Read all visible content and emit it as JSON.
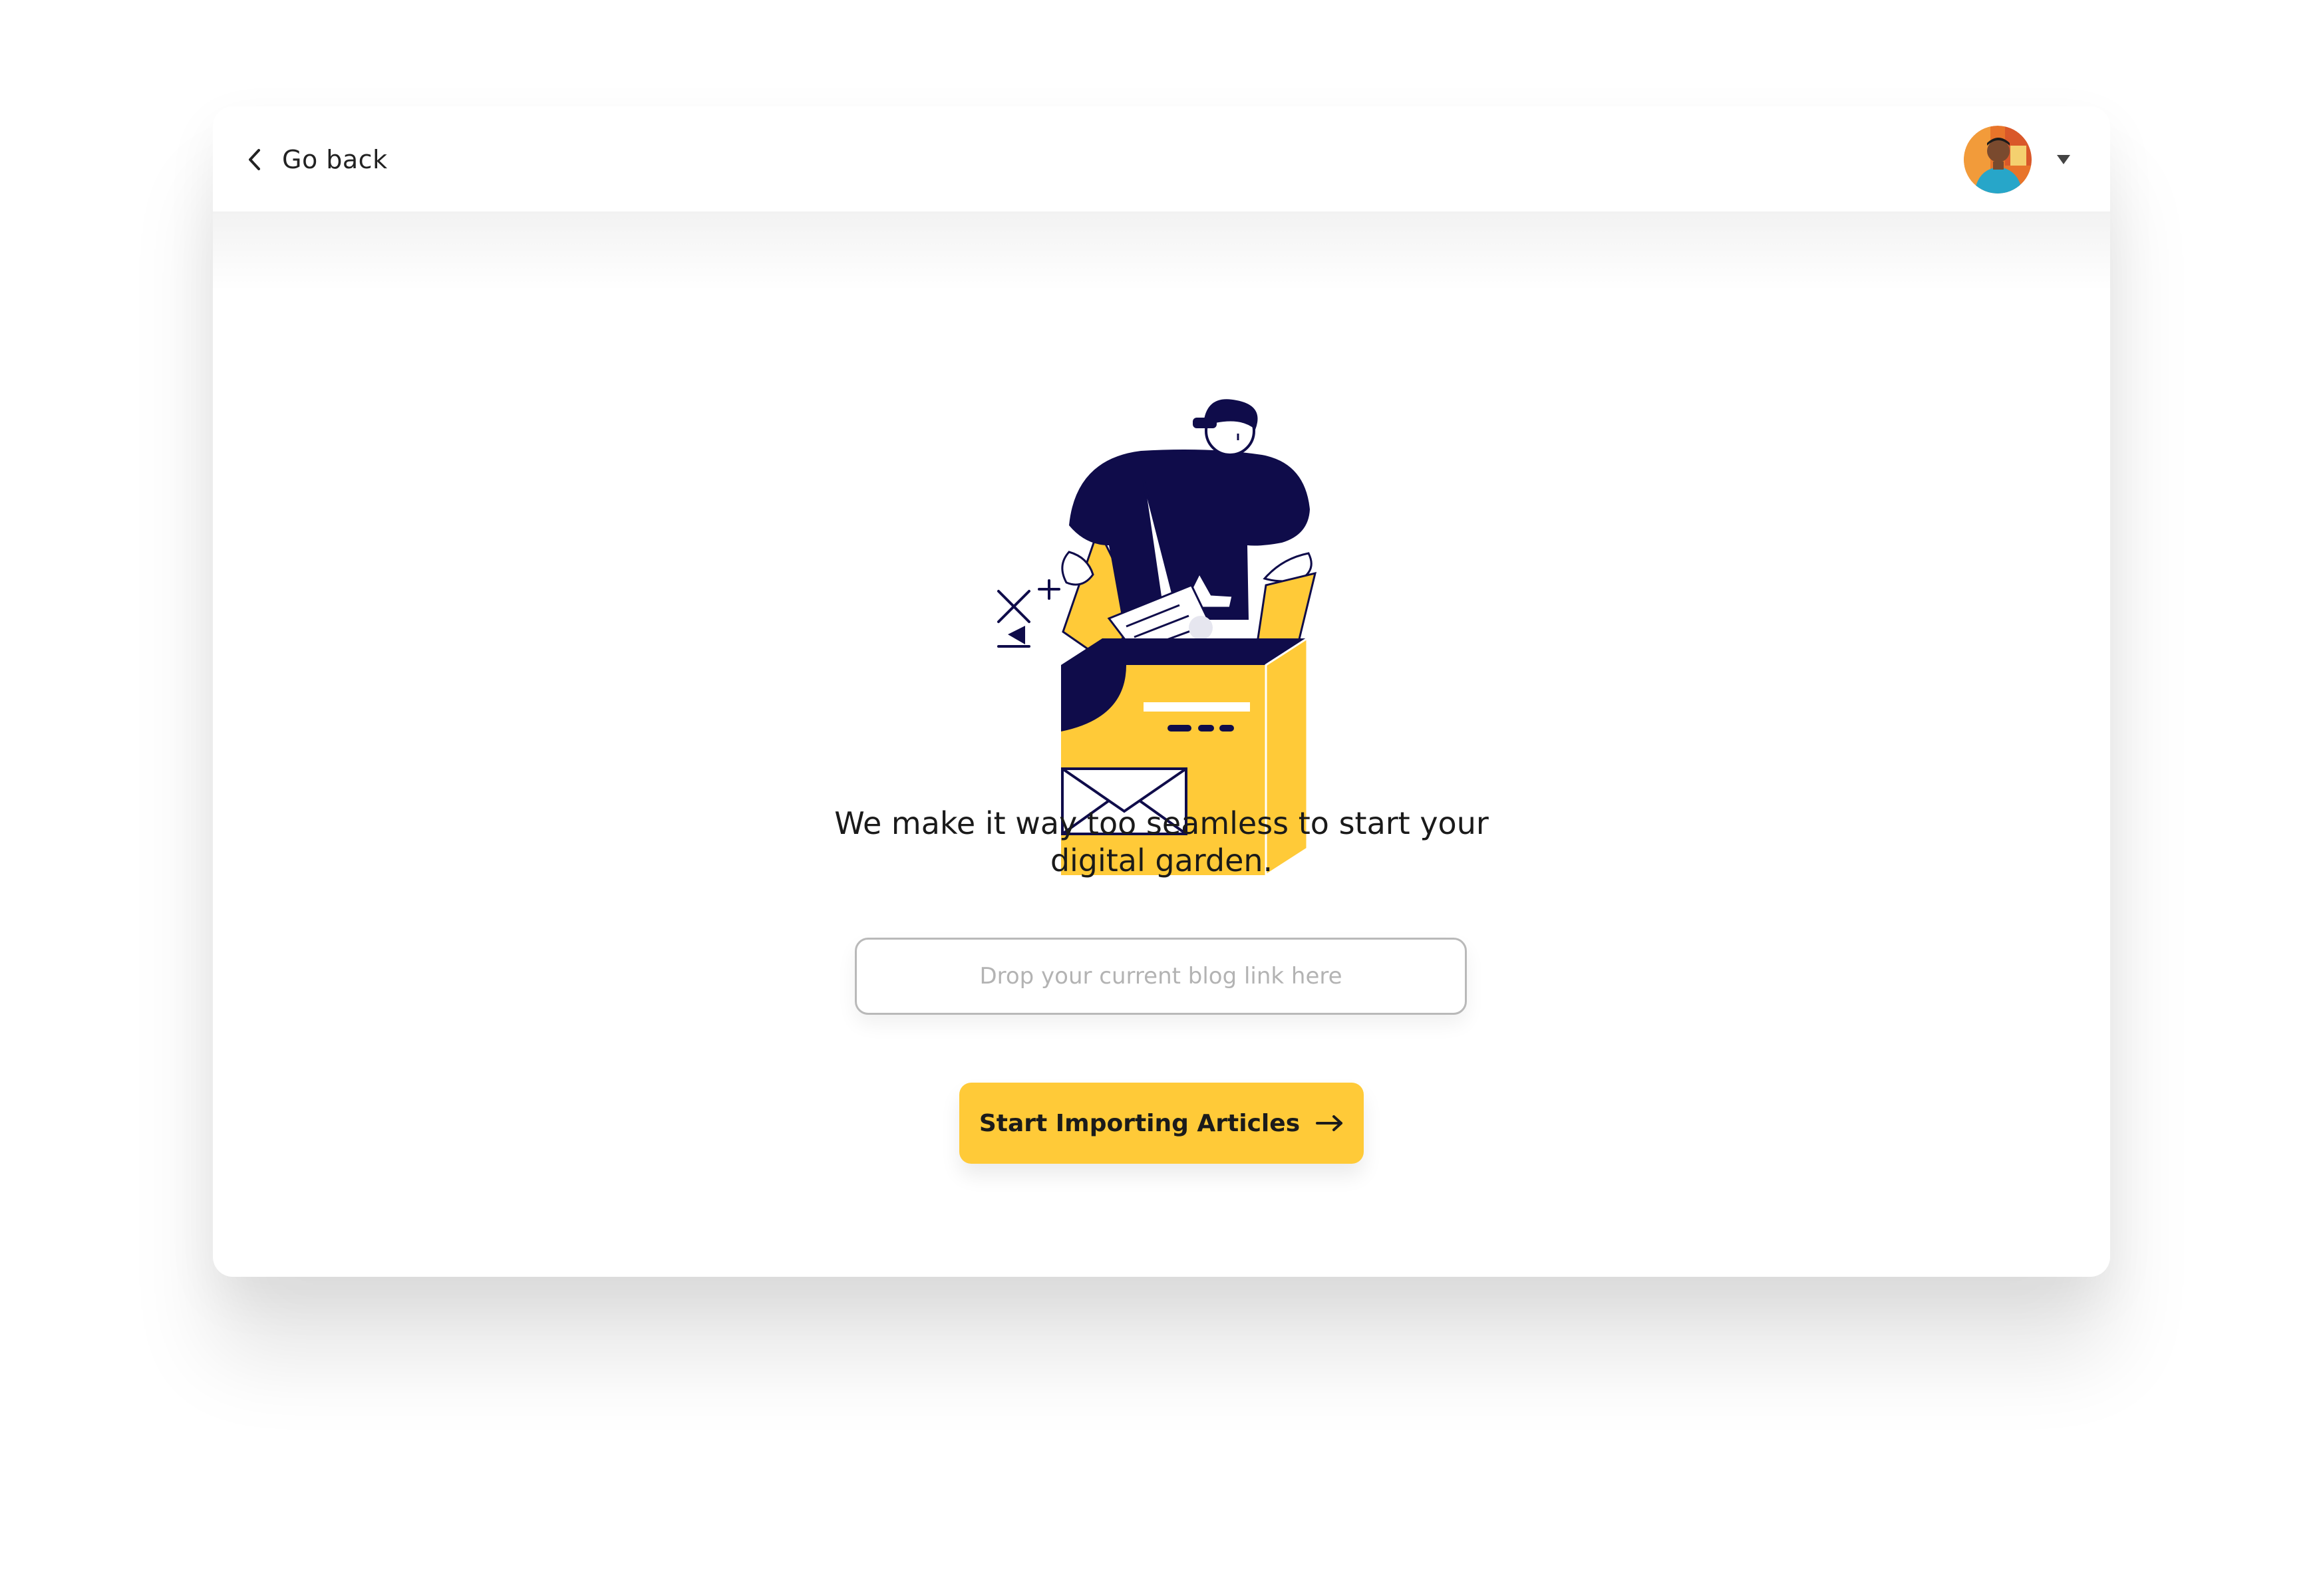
{
  "nav": {
    "back_label": "Go back"
  },
  "user": {
    "menu_icon": "chevron-down-icon"
  },
  "hero": {
    "headline_line1": "We make it way too seamless to start your",
    "headline_line2": "digital garden."
  },
  "import_form": {
    "placeholder": "Drop your current blog link here",
    "value": "",
    "button_label": "Start Importing Articles",
    "button_icon": "arrow-right-icon"
  },
  "colors": {
    "accent": "#ffca38",
    "illustration_navy": "#0f0c4a",
    "text": "#1a1a1a",
    "placeholder": "#b3b3b3"
  }
}
